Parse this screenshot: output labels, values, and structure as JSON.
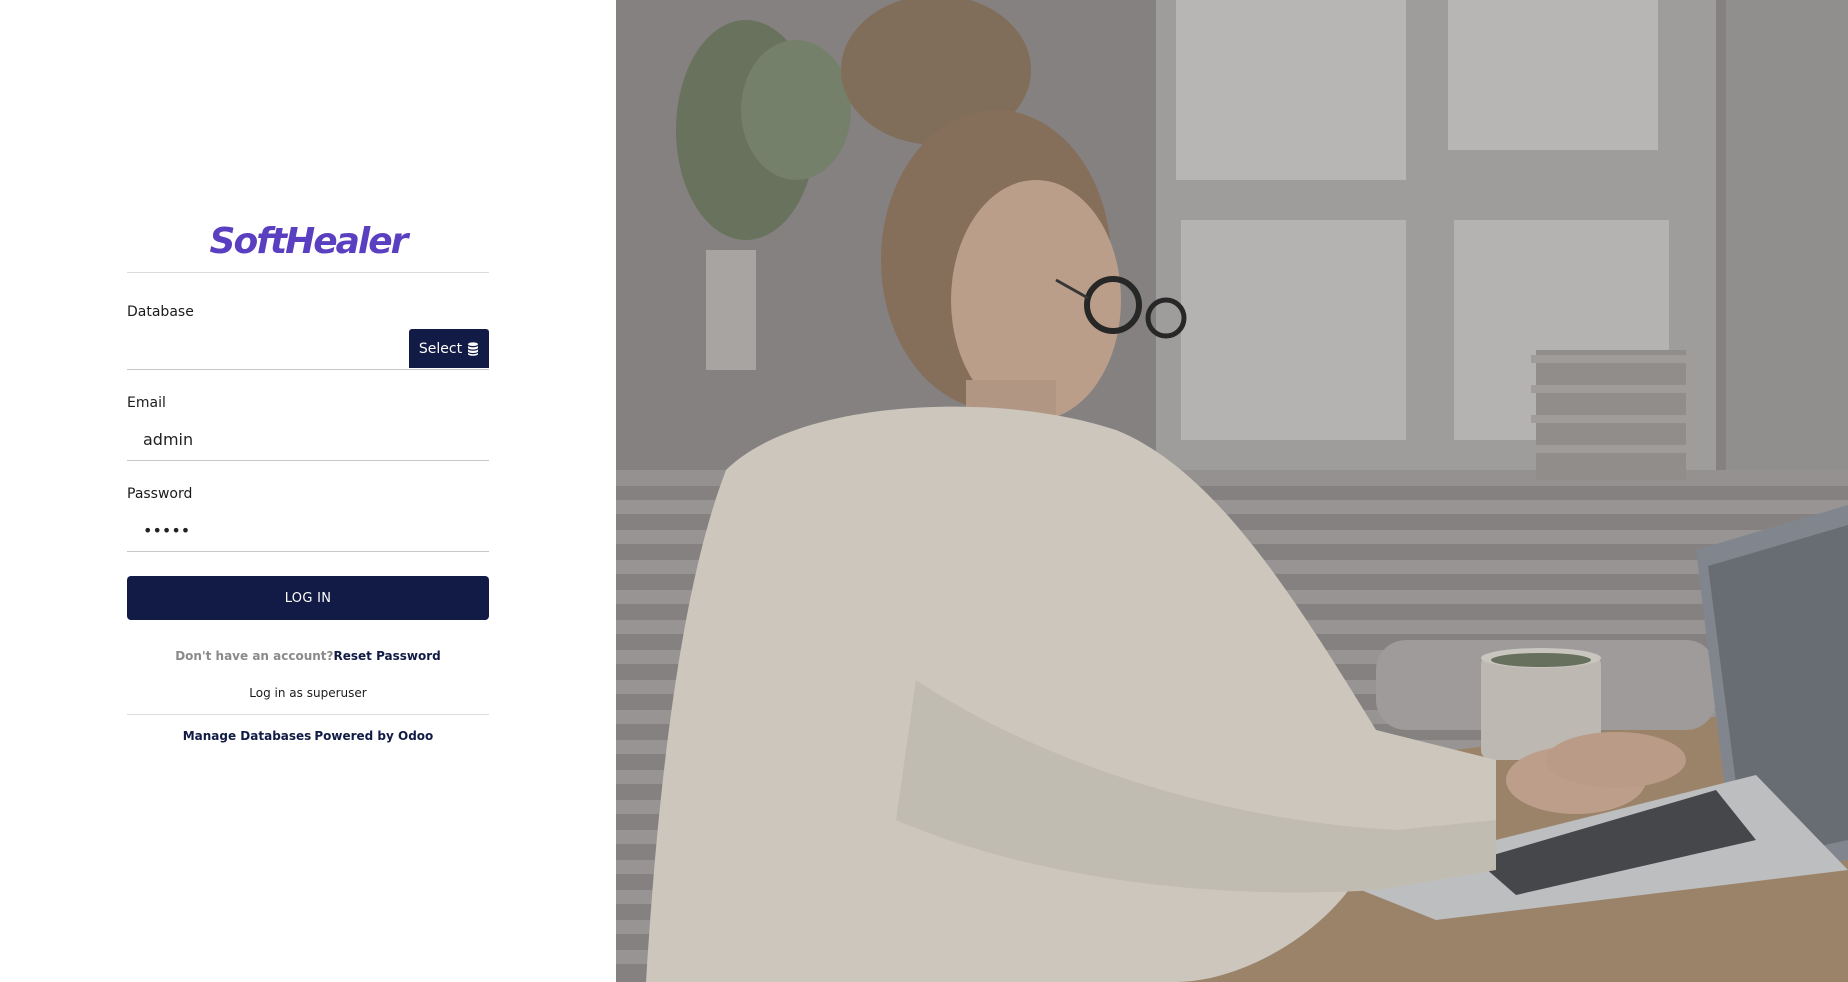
{
  "brand": {
    "logo_text": "SoftHealer",
    "color": "#5a3fc0"
  },
  "form": {
    "database_label": "Database",
    "database_value": "",
    "select_button_label": "Select",
    "select_icon": "database-icon",
    "email_label": "Email",
    "email_value": "admin",
    "password_label": "Password",
    "password_value": "•••••",
    "login_button_label": "LOG IN"
  },
  "links": {
    "no_account_text": "Don't have an account?",
    "reset_password_label": "Reset Password",
    "superuser_label": "Log in as superuser",
    "manage_databases_label": "Manage Databases",
    "powered_by_label": "Powered by Odoo"
  },
  "theme": {
    "primary": "#111b45",
    "muted": "#8a8a8a"
  }
}
